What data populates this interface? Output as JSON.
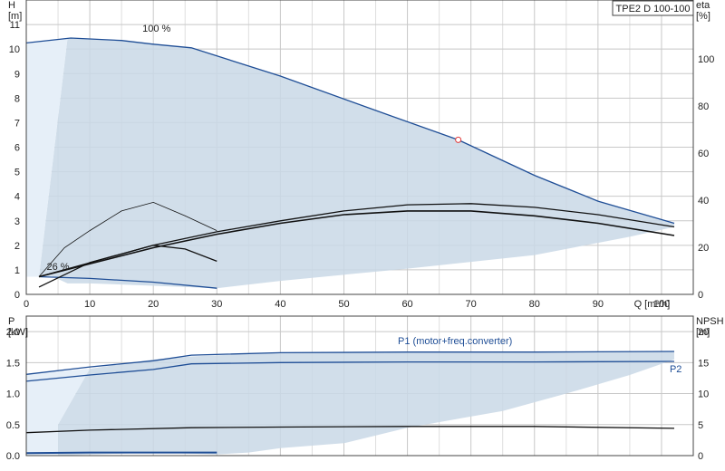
{
  "chart_data": [
    {
      "type": "line",
      "title": "",
      "product_label": "TPE2 D 100-100",
      "xlabel": "Q [m³/h]",
      "ylabel": "H\n[m]",
      "y2label": "eta\n[%]",
      "xlim": [
        0,
        105
      ],
      "ylim": [
        0,
        12
      ],
      "y2lim": [
        0,
        125
      ],
      "x_ticks": [
        0,
        10,
        20,
        30,
        40,
        50,
        60,
        70,
        80,
        90,
        100
      ],
      "y_ticks": [
        0,
        1,
        2,
        3,
        4,
        5,
        6,
        7,
        8,
        9,
        10,
        11
      ],
      "y2_ticks": [
        0,
        20,
        40,
        60,
        80,
        100
      ],
      "grid": true,
      "annotations": [
        {
          "text": "100 %",
          "x": 20.5,
          "y": 10.7
        },
        {
          "text": "26 %",
          "x": 5,
          "y": 1.0
        }
      ],
      "operating_point": {
        "x": 68,
        "y": 6.3
      },
      "area": {
        "name": "",
        "polygon": [
          [
            6.5,
            0.45
          ],
          [
            4,
            0.75
          ],
          [
            2,
            0.72
          ],
          [
            6.5,
            10.45
          ],
          [
            8,
            10.45
          ],
          [
            15,
            10.35
          ],
          [
            20,
            10.2
          ],
          [
            26,
            10.05
          ],
          [
            40,
            8.9
          ],
          [
            55,
            7.5
          ],
          [
            68,
            6.3
          ],
          [
            80,
            4.85
          ],
          [
            90,
            3.8
          ],
          [
            102,
            2.9
          ],
          [
            102,
            2.75
          ],
          [
            95,
            2.35
          ],
          [
            80,
            1.6
          ],
          [
            60,
            1.05
          ],
          [
            40,
            0.55
          ],
          [
            30,
            0.25
          ],
          [
            20,
            0.35
          ],
          [
            10,
            0.45
          ]
        ]
      },
      "series": [
        {
          "name": "",
          "values": [
            [
              0,
              10.25
            ],
            [
              7,
              10.45
            ],
            [
              15,
              10.35
            ],
            [
              20,
              10.2
            ],
            [
              26,
              10.05
            ],
            [
              40,
              8.9
            ],
            [
              55,
              7.5
            ],
            [
              68,
              6.3
            ],
            [
              80,
              4.85
            ],
            [
              90,
              3.8
            ],
            [
              102,
              2.9
            ]
          ]
        },
        {
          "name": "",
          "values": [
            [
              2,
              0.72
            ],
            [
              10,
              0.65
            ],
            [
              20,
              0.5
            ],
            [
              30,
              0.25
            ]
          ]
        },
        {
          "name": "",
          "values": [
            [
              2,
              0.72
            ],
            [
              6,
              1.9
            ],
            [
              10,
              2.6
            ],
            [
              15,
              3.4
            ],
            [
              20,
              3.75
            ],
            [
              25,
              3.2
            ],
            [
              30,
              2.6
            ]
          ]
        },
        {
          "name": "",
          "values": [
            [
              2,
              0.3
            ],
            [
              10,
              1.3
            ],
            [
              20,
              2.0
            ],
            [
              25,
              1.85
            ],
            [
              30,
              1.35
            ]
          ]
        },
        {
          "name": "",
          "values": [
            [
              2,
              0.72
            ],
            [
              20,
              1.9
            ],
            [
              30,
              2.45
            ],
            [
              40,
              2.9
            ],
            [
              50,
              3.25
            ],
            [
              60,
              3.4
            ],
            [
              70,
              3.4
            ],
            [
              80,
              3.2
            ],
            [
              90,
              2.9
            ],
            [
              102,
              2.4
            ]
          ]
        },
        {
          "name": "",
          "values": [
            [
              2,
              0.72
            ],
            [
              20,
              2.0
            ],
            [
              30,
              2.55
            ],
            [
              40,
              3.0
            ],
            [
              50,
              3.4
            ],
            [
              60,
              3.65
            ],
            [
              70,
              3.7
            ],
            [
              80,
              3.55
            ],
            [
              90,
              3.25
            ],
            [
              102,
              2.75
            ]
          ]
        }
      ]
    },
    {
      "type": "line",
      "title": "",
      "xlabel": "",
      "ylabel": "P\n[kW]",
      "y2label": "NPSH\n[m]",
      "xlim": [
        0,
        105
      ],
      "ylim": [
        0,
        2.25
      ],
      "y2lim": [
        0,
        22.5
      ],
      "y_ticks": [
        0,
        0.5,
        1.0,
        1.5,
        2.0
      ],
      "y_tick_labels": [
        "0.0",
        "0.5",
        "1.0",
        "1.5",
        "2.0"
      ],
      "y2_ticks": [
        0,
        5,
        10,
        15,
        20
      ],
      "grid": true,
      "area": {
        "name": "",
        "polygon": [
          [
            5,
            0.0
          ],
          [
            5,
            0.5
          ],
          [
            10,
            1.4
          ],
          [
            20,
            1.55
          ],
          [
            26,
            1.6
          ],
          [
            40,
            1.66
          ],
          [
            60,
            1.67
          ],
          [
            80,
            1.67
          ],
          [
            102,
            1.68
          ],
          [
            102,
            1.55
          ],
          [
            95,
            1.3
          ],
          [
            85,
            1.0
          ],
          [
            75,
            0.72
          ],
          [
            60,
            0.45
          ],
          [
            50,
            0.2
          ],
          [
            40,
            0.12
          ],
          [
            35,
            0.05
          ],
          [
            30,
            0.02
          ],
          [
            20,
            0.05
          ]
        ]
      },
      "series": [
        {
          "name": "P1 (motor+freq.converter)",
          "values": [
            [
              0,
              1.31
            ],
            [
              10,
              1.43
            ],
            [
              20,
              1.53
            ],
            [
              26,
              1.62
            ],
            [
              40,
              1.66
            ],
            [
              60,
              1.67
            ],
            [
              80,
              1.67
            ],
            [
              102,
              1.68
            ]
          ]
        },
        {
          "name": "P2",
          "values": [
            [
              0,
              1.2
            ],
            [
              10,
              1.3
            ],
            [
              20,
              1.39
            ],
            [
              26,
              1.48
            ],
            [
              40,
              1.5
            ],
            [
              60,
              1.51
            ],
            [
              80,
              1.51
            ],
            [
              102,
              1.52
            ]
          ]
        },
        {
          "name": "",
          "values": [
            [
              0,
              0.37
            ],
            [
              10,
              0.41
            ],
            [
              26,
              0.45
            ],
            [
              40,
              0.46
            ],
            [
              60,
              0.47
            ],
            [
              80,
              0.47
            ],
            [
              102,
              0.44
            ]
          ]
        },
        {
          "name": "",
          "values": [
            [
              0,
              0.04
            ],
            [
              10,
              0.05
            ],
            [
              20,
              0.05
            ],
            [
              30,
              0.05
            ]
          ]
        }
      ]
    }
  ],
  "colors": {
    "area_fill": "#c9d8e6",
    "area_edge_light": "#e6eff8",
    "curve_blue": "#1f4e96",
    "curve_black": "#111111",
    "grid": "#c8c8c8"
  }
}
